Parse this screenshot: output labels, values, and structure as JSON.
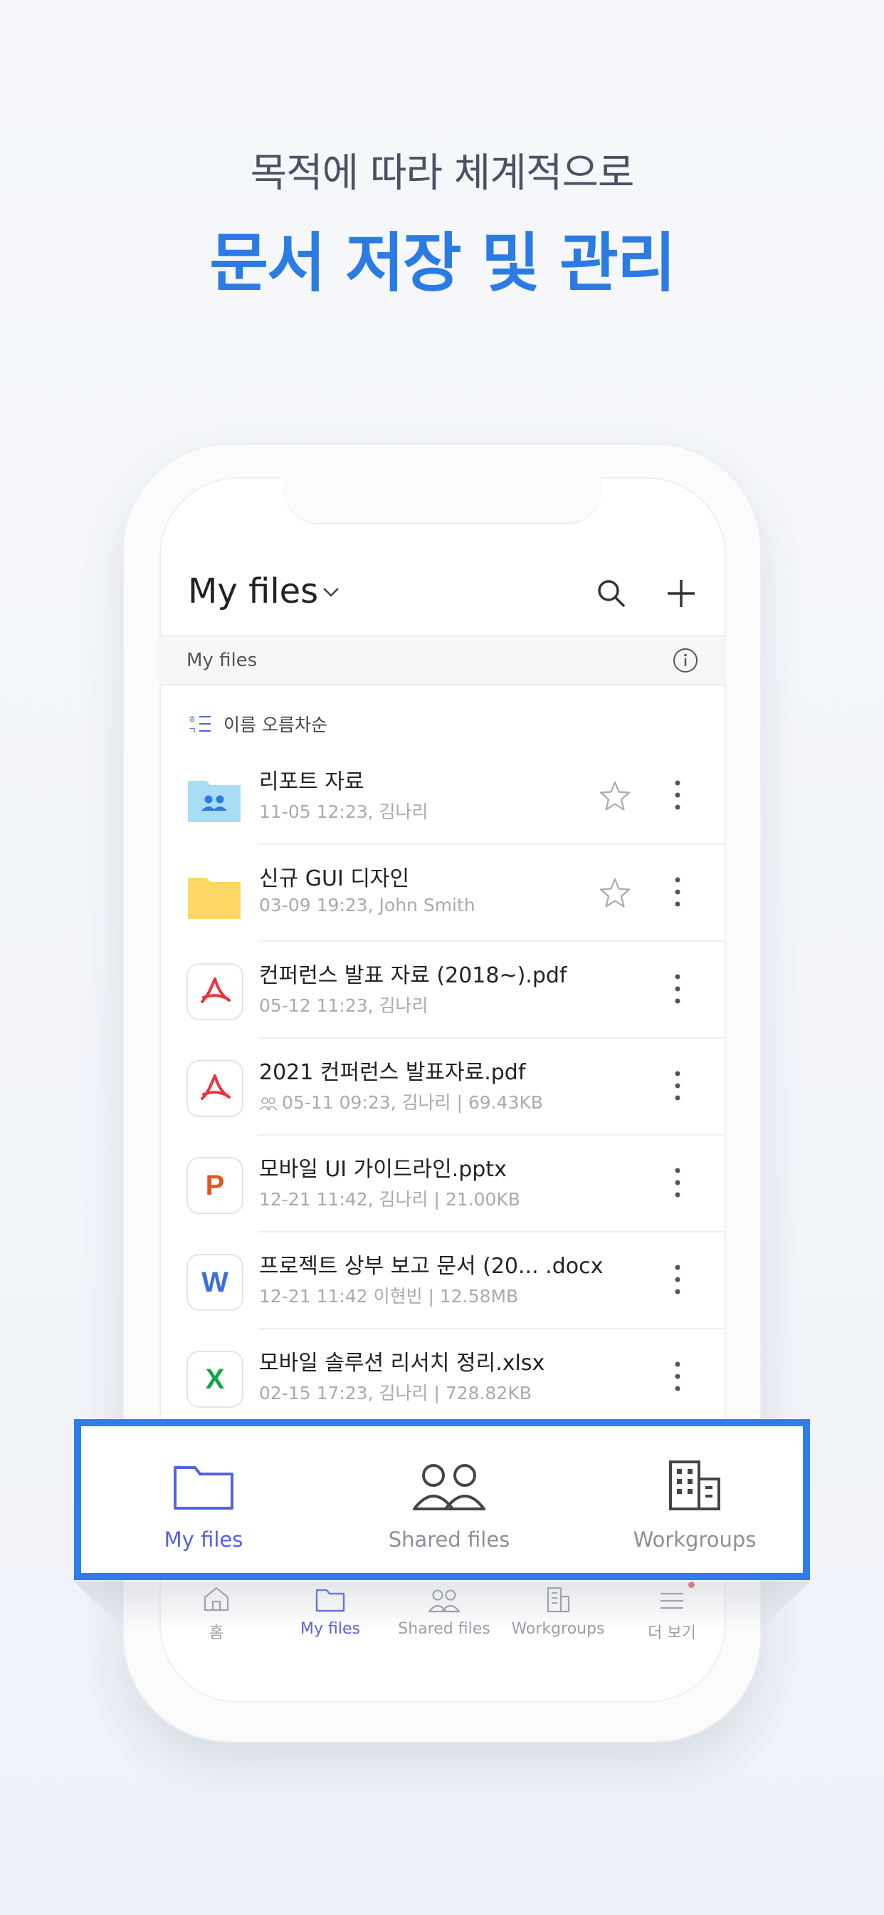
{
  "headline": {
    "sub": "목적에 따라 체계적으로",
    "main": "문서 저장 및 관리"
  },
  "header": {
    "title": "My files",
    "title_icon": "chevron-down-icon",
    "actions": [
      "search-icon",
      "plus-icon"
    ]
  },
  "breadcrumb": {
    "label": "My files",
    "icon": "info-icon"
  },
  "sort": {
    "label": "이름 오름차순",
    "icon": "sort-asc-icon"
  },
  "files": [
    {
      "name": "리포트 자료",
      "meta": "11-05 12:23, 김나리",
      "type": "shared-folder",
      "starred": false
    },
    {
      "name": "신규 GUI 디자인",
      "meta": "03-09 19:23, John Smith",
      "type": "folder",
      "starred": false
    },
    {
      "name": "컨퍼런스 발표 자료 (2018~).pdf",
      "meta": "05-12 11:23, 김나리",
      "type": "pdf"
    },
    {
      "name": "2021 컨퍼런스 발표자료.pdf",
      "meta": "05-11 09:23, 김나리 | 69.43KB",
      "type": "pdf",
      "shared": true
    },
    {
      "name": "모바일 UI 가이드라인.pptx",
      "meta": "12-21 11:42, 김나리 | 21.00KB",
      "type": "pptx",
      "letter": "P"
    },
    {
      "name": "프로젝트 상부 보고 문서 (20... .docx",
      "meta": "12-21 11:42 이현빈 | 12.58MB",
      "type": "docx",
      "letter": "W"
    },
    {
      "name": "모바일 솔루션 리서치 정리.xlsx",
      "meta": "02-15 17:23, 김나리 | 728.82KB",
      "type": "xlsx",
      "letter": "X"
    }
  ],
  "tabs": [
    {
      "label": "홈",
      "icon": "home-icon"
    },
    {
      "label": "My files",
      "icon": "folder-icon",
      "active": true
    },
    {
      "label": "Shared files",
      "icon": "people-icon"
    },
    {
      "label": "Workgroups",
      "icon": "building-icon"
    },
    {
      "label": "더 보기",
      "icon": "menu-icon",
      "badge": true
    }
  ],
  "zoom_tabs": [
    {
      "label": "My files",
      "icon": "folder-icon",
      "active": true
    },
    {
      "label": "Shared files",
      "icon": "people-icon"
    },
    {
      "label": "Workgroups",
      "icon": "building-icon"
    }
  ],
  "colors": {
    "accent": "#2b7be4",
    "active_tab": "#5560e6",
    "highlight_border": "#2d7ee8",
    "pdf": "#e8343c",
    "pptx": "#e9541f",
    "docx": "#3f6de0",
    "xlsx": "#16a34a",
    "folder": "#fcd766",
    "shared_folder": "#a9dcf5"
  }
}
